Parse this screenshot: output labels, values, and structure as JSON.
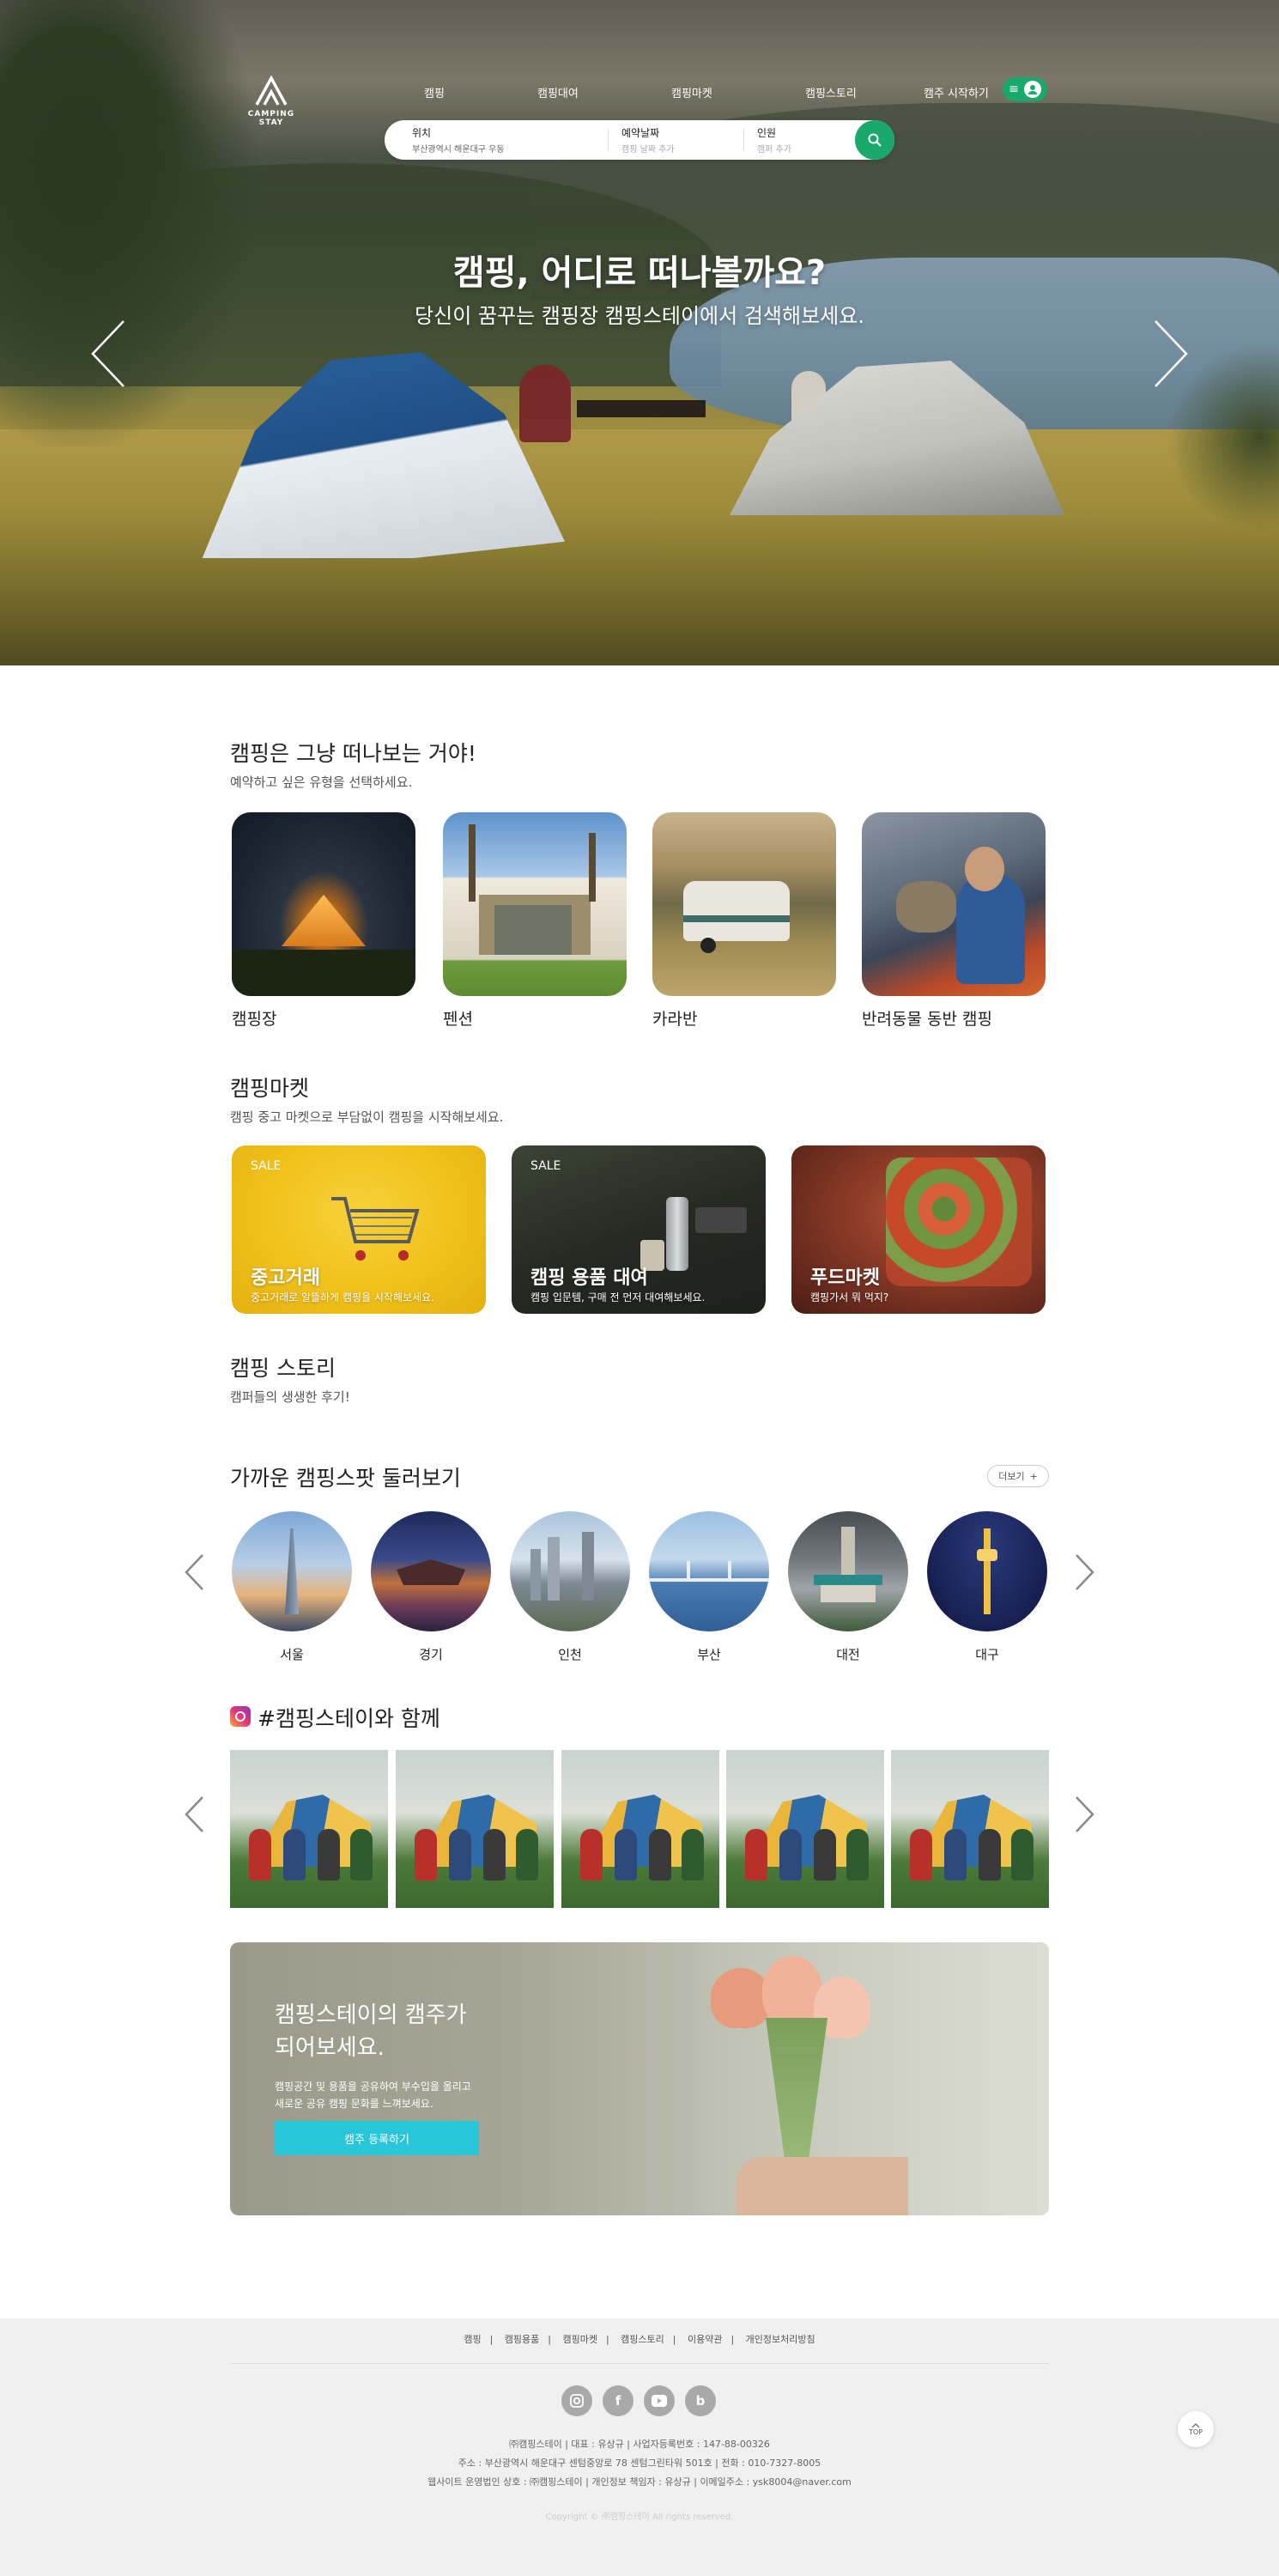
{
  "header": {
    "logo_text": "CAMPING STAY",
    "nav": [
      "캠핑",
      "캠핑대여",
      "캠핑마켓",
      "캠핑스토리",
      "캠주 시작하기"
    ]
  },
  "search": {
    "location": {
      "label": "위치",
      "value": "부산광역시 해운대구 우동"
    },
    "date": {
      "label": "예약날짜",
      "placeholder": "캠핑 날짜 추가"
    },
    "people": {
      "label": "인원",
      "placeholder": "캠퍼 추가"
    }
  },
  "hero": {
    "title": "캠핑, 어디로 떠나볼까요?",
    "subtitle": "당신이 꿈꾸는 캠핑장 캠핑스테이에서 검색해보세요."
  },
  "categories": {
    "title": "캠핑은 그냥 떠나보는 거야!",
    "desc": "예약하고 싶은 유형을 선택하세요.",
    "items": [
      {
        "label": "캠핑장"
      },
      {
        "label": "펜션"
      },
      {
        "label": "카라반"
      },
      {
        "label": "반려동물 동반 캠핑"
      }
    ]
  },
  "market": {
    "title": "캠핑마켓",
    "desc": "캠핑 중고 마켓으로 부담없이 캠핑을 시작해보세요.",
    "items": [
      {
        "badge": "SALE",
        "title": "중고거래",
        "desc": "중고거래로 알뜰하게 캠핑을 시작해보세요.",
        "color": "#f2c21c"
      },
      {
        "badge": "SALE",
        "title": "캠핑 용품 대여",
        "desc": "캠핑 입문템, 구매 전 먼저 대여해보세요.",
        "color": "#2c2f2b"
      },
      {
        "badge": "",
        "title": "푸드마켓",
        "desc": "캠핑가서 뭐 먹지?",
        "color": "#6e2b22"
      }
    ]
  },
  "story": {
    "title": "캠핑 스토리",
    "desc": "캠퍼들의 생생한 후기!"
  },
  "spots": {
    "title": "가까운 캠핑스팟 둘러보기",
    "more_label": "더보기",
    "items": [
      {
        "label": "서울"
      },
      {
        "label": "경기"
      },
      {
        "label": "인천"
      },
      {
        "label": "부산"
      },
      {
        "label": "대전"
      },
      {
        "label": "대구"
      }
    ]
  },
  "instagram": {
    "title": "#캠핑스테이와 함께"
  },
  "host_banner": {
    "title": "캠핑스테이의 캠주가\n되어보세요.",
    "desc": "캠핑공간 및 용품을 공유하여 부수입을 올리고\n새로운 공유 캠핑 문화를 느껴보세요.",
    "button": "캠주 등록하기"
  },
  "footer": {
    "links": [
      "캠핑",
      "캠핑용품",
      "캠핑마켓",
      "캠핑스토리",
      "이용약관",
      "개인정보처리방침"
    ],
    "social": [
      "instagram-icon",
      "facebook-icon",
      "youtube-icon",
      "blog-icon"
    ],
    "info1": "㈜캠핑스테이  |  대표 : 유상규  |  사업자등록번호 : 147-88-00326",
    "info2": "주소 : 부산광역시 해운대구 센텀중앙로 78 센텀그린타워 501호  |  전화 : 010-7327-8005",
    "info3": "웹사이트 운영법인 상호 : ㈜캠핑스테이  |  개인정보 책임자 : 유상규  |  이메일주소 : ysk8004@naver.com",
    "copyright": "Copyright © ㈜캠핑스테이 All rights reserved.",
    "top_label": "TOP"
  },
  "colors": {
    "accent": "#18a96b",
    "cta": "#27c6d8"
  }
}
